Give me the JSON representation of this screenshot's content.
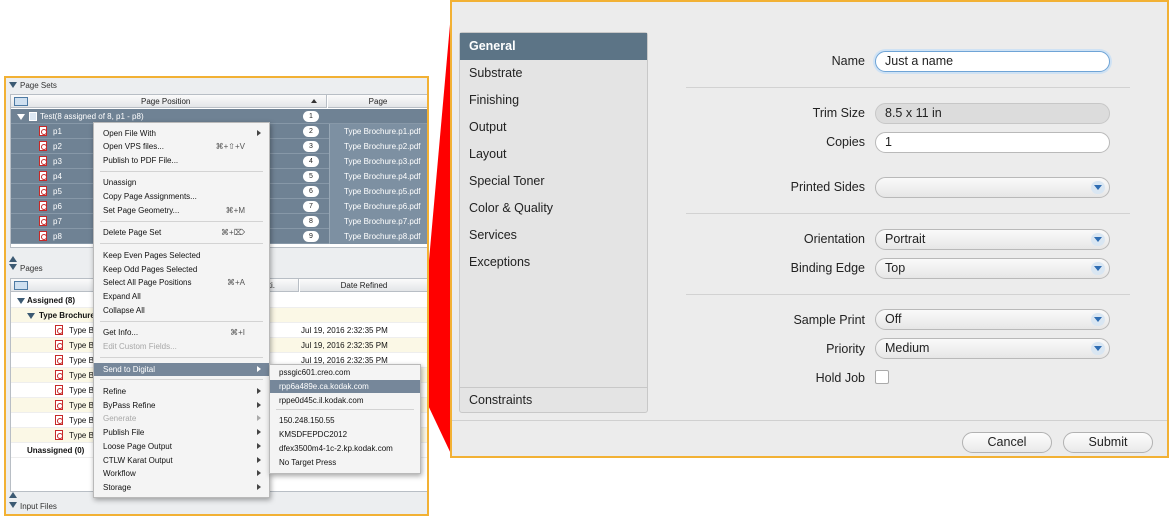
{
  "left_panel": {
    "page_sets": {
      "title": "Page Sets",
      "col_position": "Page Position",
      "col_page": "Page",
      "group_label": "Test(8 assigned of 8, p1 - p8)",
      "group_num": "1",
      "rows": [
        {
          "name": "p1",
          "num": "2",
          "file": "Type Brochure.p1.pdf"
        },
        {
          "name": "p2",
          "num": "3",
          "file": "Type Brochure.p2.pdf"
        },
        {
          "name": "p3",
          "num": "4",
          "file": "Type Brochure.p3.pdf"
        },
        {
          "name": "p4",
          "num": "5",
          "file": "Type Brochure.p4.pdf"
        },
        {
          "name": "p5",
          "num": "6",
          "file": "Type Brochure.p5.pdf"
        },
        {
          "name": "p6",
          "num": "7",
          "file": "Type Brochure.p6.pdf"
        },
        {
          "name": "p7",
          "num": "8",
          "file": "Type Brochure.p7.pdf"
        },
        {
          "name": "p8",
          "num": "9",
          "file": "Type Brochure.p8.pdf"
        }
      ]
    },
    "pages": {
      "title": "Pages",
      "col_position": "siti.",
      "col_date": "Date Refined",
      "assigned": "Assigned (8)",
      "brochure": "Type Brochure.p",
      "unassigned": "Unassigned (0)",
      "rows": [
        {
          "label": "Type Bro",
          "date": ""
        },
        {
          "label": "Type Bro",
          "date": "Jul 19, 2016 2:32:35 PM"
        },
        {
          "label": "Type Bro",
          "date": "Jul 19, 2016 2:32:35 PM"
        },
        {
          "label": "Type Bro",
          "date": "Jul 19, 2016 2:32:35 PM"
        },
        {
          "label": "Type Bro",
          "date": ""
        },
        {
          "label": "Type Bro",
          "date": ""
        },
        {
          "label": "Type Bro",
          "date": ""
        },
        {
          "label": "Type Bro",
          "date": ""
        },
        {
          "label": "Type Bro",
          "date": ""
        }
      ]
    },
    "input_files": {
      "title": "Input Files"
    },
    "context_menu": {
      "open_file_with": "Open File With",
      "open_vps": "Open VPS files...",
      "open_vps_sc": "⌘+⇧+V",
      "publish_pdf": "Publish to PDF File...",
      "unassign": "Unassign",
      "copy_assign": "Copy Page Assignments...",
      "set_geometry": "Set Page Geometry...",
      "set_geometry_sc": "⌘+M",
      "delete_set": "Delete Page Set",
      "delete_set_sc": "⌘+⌦",
      "keep_even": "Keep Even Pages Selected",
      "keep_odd": "Keep Odd Pages Selected",
      "select_all": "Select All Page Positions",
      "select_all_sc": "⌘+A",
      "expand_all": "Expand All",
      "collapse_all": "Collapse All",
      "get_info": "Get Info...",
      "get_info_sc": "⌘+I",
      "edit_custom": "Edit Custom Fields...",
      "send_digital": "Send to Digital",
      "refine": "Refine",
      "bypass_refine": "ByPass Refine",
      "generate": "Generate",
      "publish_file": "Publish File",
      "loose_page": "Loose Page Output",
      "ctlw_karat": "CTLW Karat Output",
      "workflow": "Workflow",
      "storage": "Storage"
    },
    "submenu": {
      "items": [
        "pssgic601.creo.com",
        "rpp6a489e.ca.kodak.com",
        "rppe0d45c.il.kodak.com"
      ],
      "items2": [
        "150.248.150.55",
        "KMSDFEPDC2012",
        "dfex3500m4-1c-2.kp.kodak.com",
        "No Target Press"
      ]
    }
  },
  "dialog": {
    "sidebar": [
      "General",
      "Substrate",
      "Finishing",
      "Output",
      "Layout",
      "Special Toner",
      "Color & Quality",
      "Services",
      "Exceptions"
    ],
    "sidebar_bottom": "Constraints",
    "fields": {
      "name_label": "Name",
      "name_value": "Just a name",
      "trim_label": "Trim Size",
      "trim_value": "8.5 x 11 in",
      "copies_label": "Copies",
      "copies_value": "1",
      "printed_label": "Printed Sides",
      "printed_value": "",
      "orientation_label": "Orientation",
      "orientation_value": "Portrait",
      "binding_label": "Binding Edge",
      "binding_value": "Top",
      "sample_label": "Sample Print",
      "sample_value": "Off",
      "priority_label": "Priority",
      "priority_value": "Medium",
      "hold_label": "Hold Job"
    },
    "cancel": "Cancel",
    "submit": "Submit"
  },
  "colors": {
    "highlight": "#f2b134",
    "connector": "#ff0000",
    "selection": "#5c7486"
  }
}
